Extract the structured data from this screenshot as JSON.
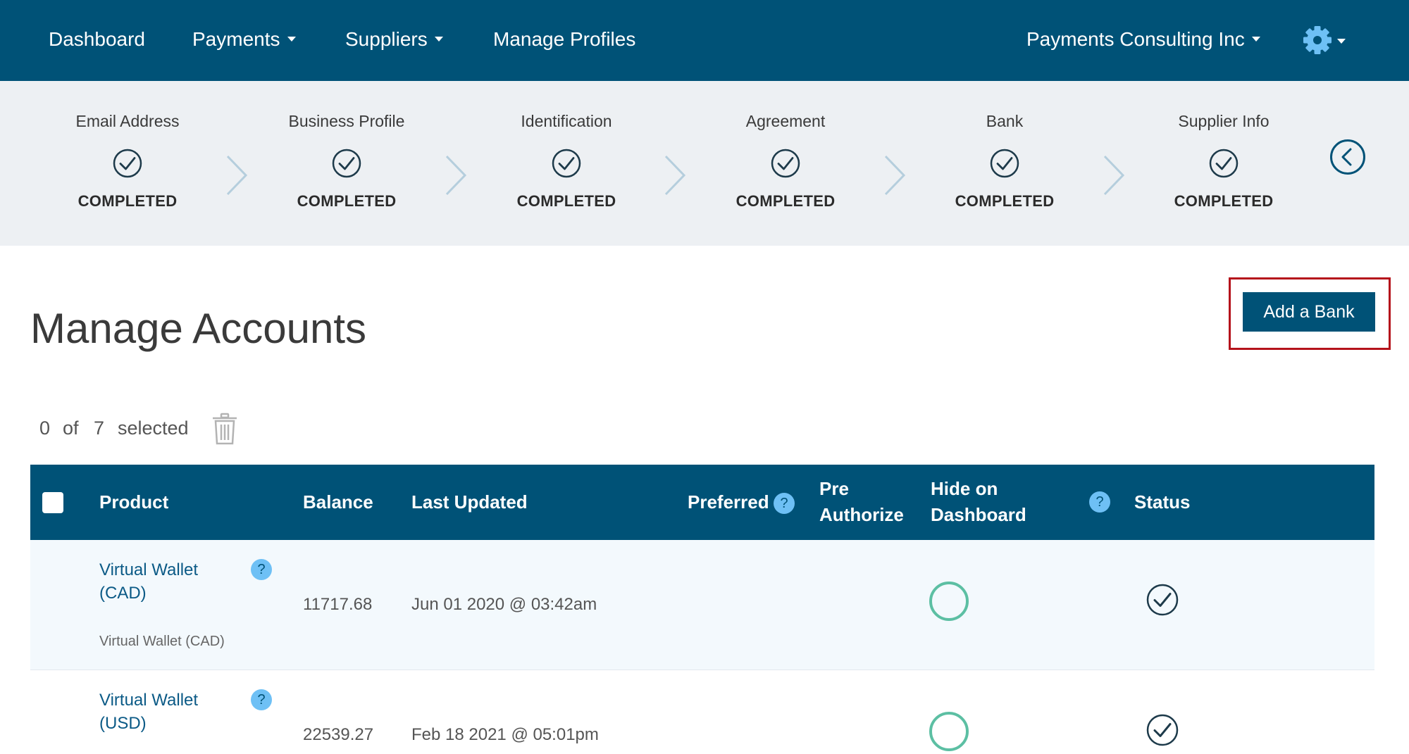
{
  "nav": {
    "dashboard": "Dashboard",
    "payments": "Payments",
    "suppliers": "Suppliers",
    "manage_profiles": "Manage Profiles",
    "company": "Payments Consulting Inc",
    "settings_icon": "gear-icon"
  },
  "stepper": {
    "steps": [
      {
        "label": "Email Address",
        "status": "COMPLETED"
      },
      {
        "label": "Business Profile",
        "status": "COMPLETED"
      },
      {
        "label": "Identification",
        "status": "COMPLETED"
      },
      {
        "label": "Agreement",
        "status": "COMPLETED"
      },
      {
        "label": "Bank",
        "status": "COMPLETED"
      },
      {
        "label": "Supplier Info",
        "status": "COMPLETED"
      }
    ]
  },
  "page": {
    "title": "Manage Accounts",
    "add_bank": "Add a Bank"
  },
  "selection": {
    "count": "0",
    "of": "of",
    "total": "7",
    "selected": "selected"
  },
  "table": {
    "headers": {
      "product": "Product",
      "balance": "Balance",
      "last_updated": "Last Updated",
      "preferred": "Preferred",
      "pre_authorize_1": "Pre",
      "pre_authorize_2": "Authorize",
      "hide_1": "Hide on",
      "hide_2": "Dashboard",
      "status": "Status"
    },
    "help_mark": "?",
    "rows": [
      {
        "product_line1": "Virtual Wallet",
        "product_line2": "(CAD)",
        "product_sub": "Virtual Wallet (CAD)",
        "balance": "11717.68",
        "last_updated": "Jun 01 2020 @ 03:42am"
      },
      {
        "product_line1": "Virtual Wallet",
        "product_line2": "(USD)",
        "balance": "22539.27",
        "last_updated": "Feb 18 2021 @ 05:01pm"
      }
    ]
  },
  "colors": {
    "primary": "#005277",
    "stepper_bg": "#edf0f3",
    "help_blue": "#6ec0f5",
    "toggle_green": "#5cbfa3",
    "highlight_red": "#b5121b"
  }
}
